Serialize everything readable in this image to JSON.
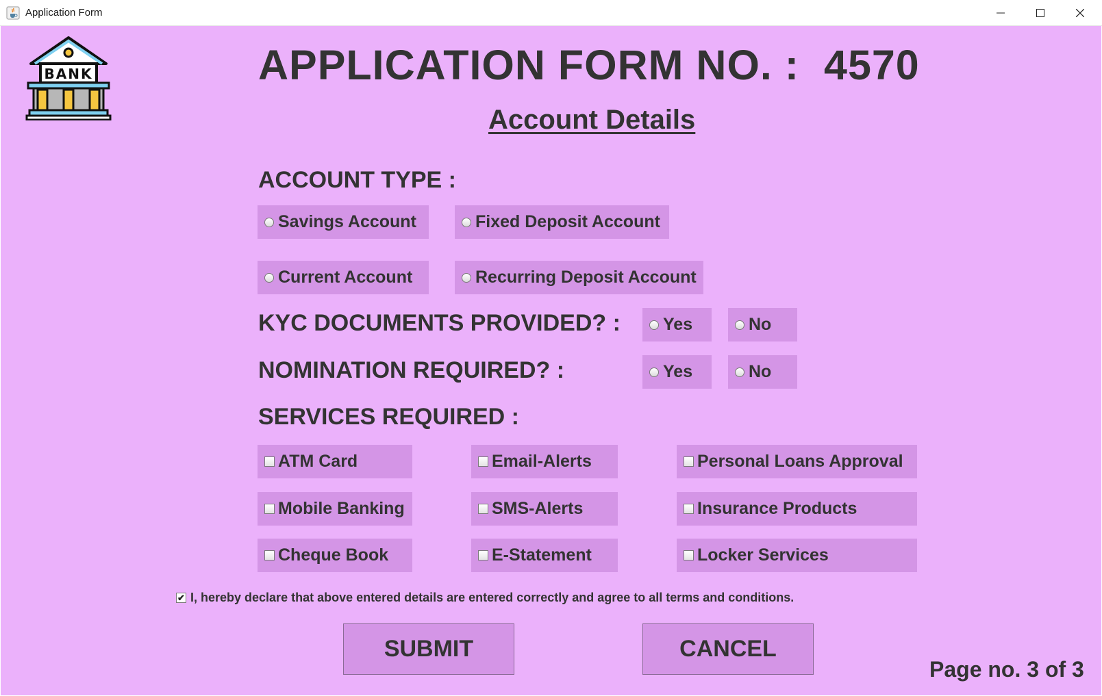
{
  "window": {
    "title": "Application Form",
    "app_icon": "java-cup-icon",
    "controls": [
      "minimize-icon",
      "maximize-icon",
      "close-icon"
    ]
  },
  "logo": {
    "icon": "bank-building-icon",
    "text": "BANK"
  },
  "form": {
    "title_prefix": "APPLICATION FORM NO. :",
    "number": "4570",
    "section_title": "Account Details"
  },
  "account_type": {
    "heading": "ACCOUNT TYPE :",
    "options": [
      "Savings Account",
      "Fixed Deposit Account",
      "Current Account",
      "Recurring Deposit Account"
    ]
  },
  "kyc": {
    "heading": "KYC DOCUMENTS PROVIDED? :",
    "yes": "Yes",
    "no": "No"
  },
  "nomination": {
    "heading": "NOMINATION REQUIRED? :",
    "yes": "Yes",
    "no": "No"
  },
  "services": {
    "heading": "SERVICES REQUIRED :",
    "options": [
      "ATM Card",
      "Email-Alerts",
      "Personal Loans Approval",
      "Mobile Banking",
      "SMS-Alerts",
      "Insurance Products",
      "Cheque Book",
      "E-Statement",
      "Locker Services"
    ]
  },
  "declaration": {
    "checked": true,
    "text": "I, hereby declare that above entered details are entered correctly and agree to all terms and conditions."
  },
  "buttons": {
    "submit": "SUBMIT",
    "cancel": "CANCEL"
  },
  "page_no": "Page no. 3 of 3",
  "colors": {
    "background": "#ebb1fb",
    "option_bg": "#d495e6",
    "text": "#333333"
  }
}
